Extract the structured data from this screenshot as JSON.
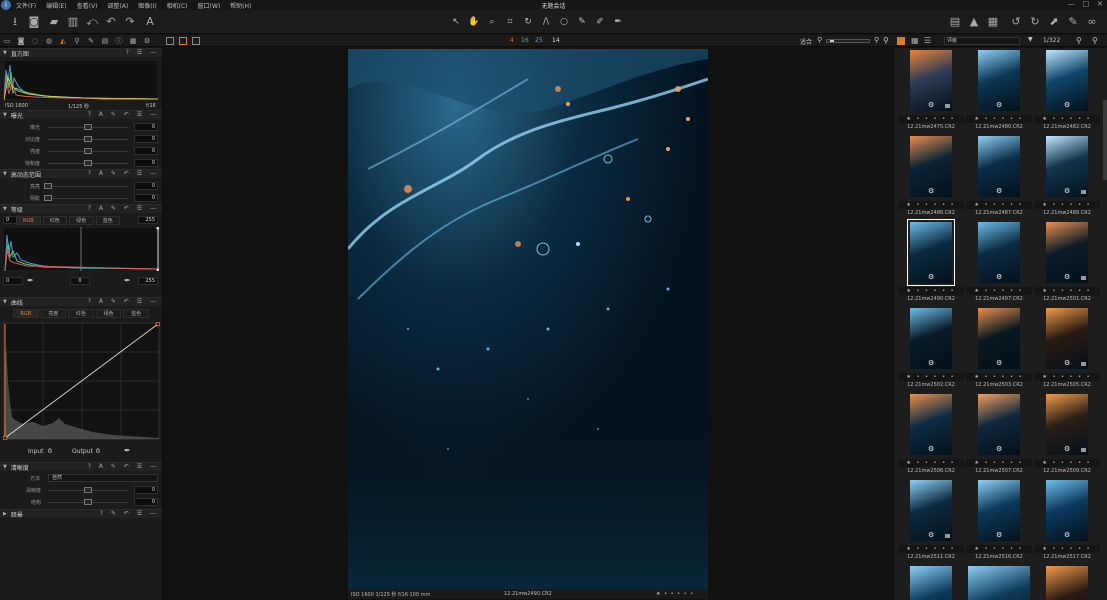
{
  "window": {
    "title": "无题会话"
  },
  "menu": [
    "文件(F)",
    "编辑(E)",
    "查看(V)",
    "调整(A)",
    "图像(I)",
    "相机(C)",
    "窗口(W)",
    "帮助(H)"
  ],
  "subbar": {
    "nums": [
      "4",
      "16",
      "25",
      "14"
    ],
    "zoom_label": "适合",
    "search_value": "评级",
    "counter": "1/322"
  },
  "colors": {
    "accent": "#e07b2c",
    "panel": "#1b1b1b",
    "bg": "#111111"
  },
  "histogram": {
    "title": "直方图",
    "iso": "ISO 1600",
    "shutter": "1/125 秒",
    "aperture": "f/16"
  },
  "exposure": {
    "title": "曝光",
    "rows": [
      {
        "label": "曝光",
        "value": "0"
      },
      {
        "label": "对比度",
        "value": "0"
      },
      {
        "label": "亮度",
        "value": "0"
      },
      {
        "label": "饱和度",
        "value": "0"
      }
    ]
  },
  "hdr": {
    "title": "高动态范围",
    "rows": [
      {
        "label": "高亮",
        "value": "0"
      },
      {
        "label": "阴影",
        "value": "0"
      }
    ]
  },
  "levels": {
    "title": "等级",
    "left": "0",
    "right": "255",
    "channels": [
      "RGB",
      "红色",
      "绿色",
      "蓝色"
    ],
    "b_left": "0",
    "b_mid": "0",
    "b_right": "255"
  },
  "curves": {
    "title": "曲线",
    "channels": [
      "RGB",
      "亮度",
      "红色",
      "绿色",
      "蓝色"
    ],
    "input_label": "Input",
    "input_value": "0",
    "output_label": "Output",
    "output_value": "0"
  },
  "clarity": {
    "title": "清晰度",
    "method_label": "方法",
    "method_value": "自然",
    "rows": [
      {
        "label": "清晰度",
        "value": "0"
      },
      {
        "label": "结构",
        "value": "0"
      }
    ]
  },
  "vignette": {
    "title": "暗晕"
  },
  "photo": {
    "info": "ISO 1600  1/125 秒  f/16  100 mm",
    "filename": "12.21mw2490.CR2",
    "stars": "★ • • • • •"
  },
  "thumbnails": [
    {
      "name": "12.21mw2475.CR2",
      "stars": "★ • • • • •"
    },
    {
      "name": "12.21mw2480.CR2",
      "stars": "★ • • • • •"
    },
    {
      "name": "12.21mw2482.CR2",
      "stars": "★ • • • • •"
    },
    {
      "name": "12.21mw2486.CR2",
      "stars": "★ • • • • •"
    },
    {
      "name": "12.21mw2487.CR2",
      "stars": "★ • • • • •"
    },
    {
      "name": "12.21mw2488.CR2",
      "stars": "★ • • • • •"
    },
    {
      "name": "12.21mw2490.CR2",
      "stars": "★ • • • • •"
    },
    {
      "name": "12.21mw2497.CR2",
      "stars": "★ • • • • •"
    },
    {
      "name": "12.21mw2501.CR2",
      "stars": "★ • • • • •"
    },
    {
      "name": "12.21mw2502.CR2",
      "stars": "★ • • • • •"
    },
    {
      "name": "12.21mw2503.CR2",
      "stars": "★ • • • • •"
    },
    {
      "name": "12.21mw2505.CR2",
      "stars": "★ • • • • •"
    },
    {
      "name": "12.21mw2506.CR2",
      "stars": "★ • • • • •"
    },
    {
      "name": "12.21mw2507.CR2",
      "stars": "★ • • • • •"
    },
    {
      "name": "12.21mw2509.CR2",
      "stars": "★ • • • • •"
    },
    {
      "name": "12.21mw2511.CR2",
      "stars": "★ • • • • •"
    },
    {
      "name": "12.21mw2516.CR2",
      "stars": "★ • • • • •"
    },
    {
      "name": "12.21mw2517.CR2",
      "stars": "★ • • • • •"
    }
  ]
}
